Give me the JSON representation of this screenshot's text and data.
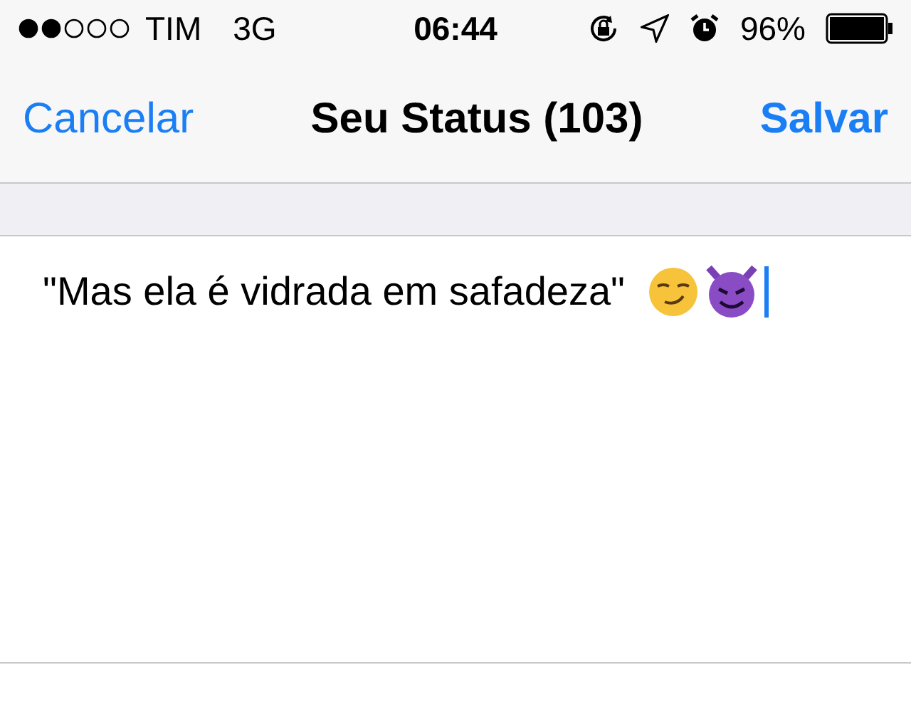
{
  "status_bar": {
    "carrier": "TIM",
    "network": "3G",
    "time": "06:44",
    "battery": "96%"
  },
  "nav_bar": {
    "left_button": "Cancelar",
    "title": "Seu Status (103)",
    "right_button": "Salvar"
  },
  "status_field": {
    "value": "\"Mas ela é vidrada em safadeza\""
  }
}
